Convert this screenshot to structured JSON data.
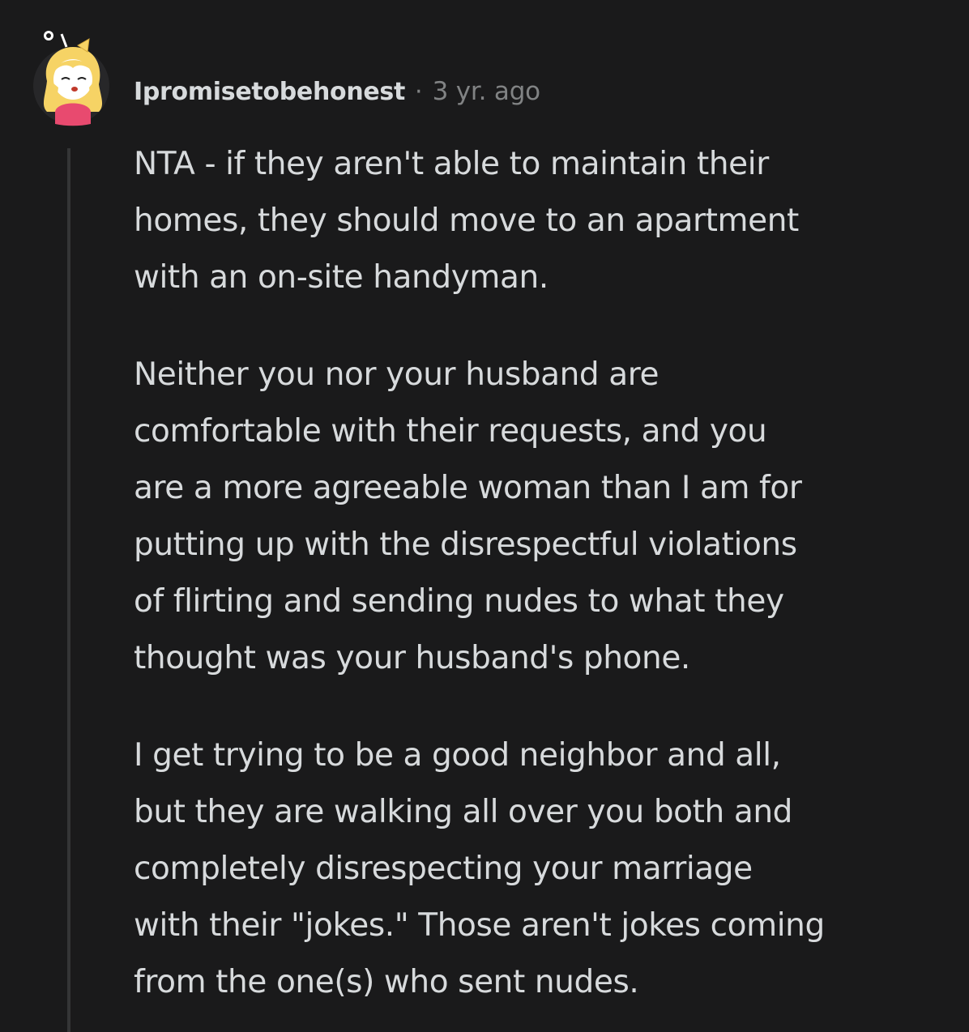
{
  "comment": {
    "author": "Ipromisetobehonest",
    "separator": "·",
    "timestamp": "3 yr. ago",
    "paragraphs": [
      "NTA - if they aren't able to maintain their\nhomes, they should move to an apartment\nwith an on-site handyman.",
      "Neither you nor your husband are\ncomfortable with their requests, and you\nare a more agreeable woman than I am for\nputting up with the disrespectful violations\nof flirting and sending nudes to what they\nthought was your husband's phone.",
      "I get trying to be a good neighbor and all,\nbut they are walking all over you both and\ncompletely disrespecting your marriage\nwith their \"jokes.\" Those aren't jokes coming\nfrom the one(s) who sent nudes."
    ]
  },
  "colors": {
    "background": "#1a1a1b",
    "text": "#d7dadc",
    "meta": "#818384",
    "thread_line": "#343536",
    "avatar_hair": "#f6d365",
    "avatar_shirt": "#e84a6f"
  },
  "icons": {
    "avatar": "user-avatar-icon"
  }
}
